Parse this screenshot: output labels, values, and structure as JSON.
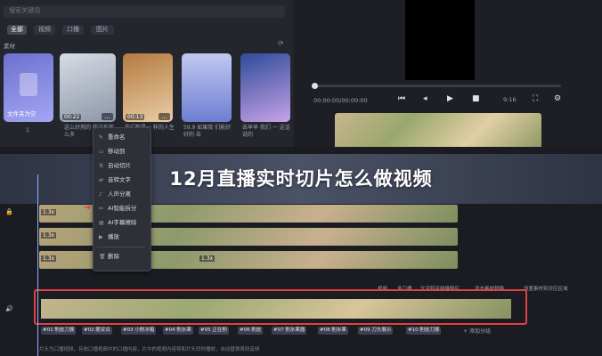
{
  "search": {
    "placeholder": "搜索关键词"
  },
  "media_tabs": [
    {
      "label": "全部",
      "active": true
    },
    {
      "label": "视频",
      "active": false
    },
    {
      "label": "口播",
      "active": false
    },
    {
      "label": "图片",
      "active": false
    }
  ],
  "section_label": "素材",
  "thumbnails": [
    {
      "caption": "文件夹为空",
      "duration": "",
      "count": "1",
      "colors": [
        "#7b7fd6",
        "#9ea2f0"
      ]
    },
    {
      "caption": "这么好用的 我这有那么多",
      "duration": "00:22",
      "colors": [
        "#c9d0db",
        "#8d97a8"
      ]
    },
    {
      "caption": "我们都是一 样的人生 如果",
      "duration": "00:13",
      "colors": [
        "#c48a4f",
        "#e8c9a2"
      ]
    },
    {
      "caption": "59.9 如果我 们能好好的 去",
      "duration": "",
      "colors": [
        "#a7b3e8",
        "#6f7fd0"
      ]
    },
    {
      "caption": "去早早 我们 一 这话说的",
      "duration": "",
      "colors": [
        "#4e6fb8",
        "#c5a5e4"
      ]
    }
  ],
  "thumb_more": "...",
  "preview": {
    "timecode": "00:00:00/00:00:00",
    "ratio": "9:16"
  },
  "context_menu": {
    "items": [
      {
        "icon": "✎",
        "label": "重命名"
      },
      {
        "icon": "▭",
        "label": "移动到"
      },
      {
        "icon": "⇅",
        "label": "自动切片"
      },
      {
        "icon": "⇄",
        "label": "音转文字"
      },
      {
        "icon": "♪",
        "label": "人声分离"
      },
      {
        "icon": "✂",
        "label": "AI智能拆分"
      },
      {
        "icon": "▤",
        "label": "AI字幕擦除"
      },
      {
        "icon": "▶",
        "label": "播放"
      },
      {
        "icon": "🗑",
        "label": "删除"
      }
    ]
  },
  "banner": {
    "title": "12月直播实时切片怎么做视频"
  },
  "timeline": {
    "track_speeds": [
      "1.3x",
      "1.3x",
      "1.3x",
      "1.3x"
    ],
    "hints": [
      "视频",
      "多口播",
      "文字转音频编辑区",
      "双击素材替换",
      "设置素材到对应区域"
    ],
    "segment_labels": [
      "#01 削皮刀展",
      "#02 脆甘瓜",
      "#03 小削冰箱",
      "#04 削水果",
      "#05 正在削",
      "#06 削皮",
      "#07 削水果器",
      "#08 削水果",
      "#09 刀头展示",
      "#10 削皮刀展"
    ],
    "add_group": "添加分组",
    "footer": "片头为口播视频，存放口播视频中的口播内容，片中的视频内容将和片头同时播放，自动替换首段音频"
  },
  "colors": {
    "accent": "#e0413f",
    "playhead": "#8fb1ff",
    "banner_text": "#ffffff"
  }
}
